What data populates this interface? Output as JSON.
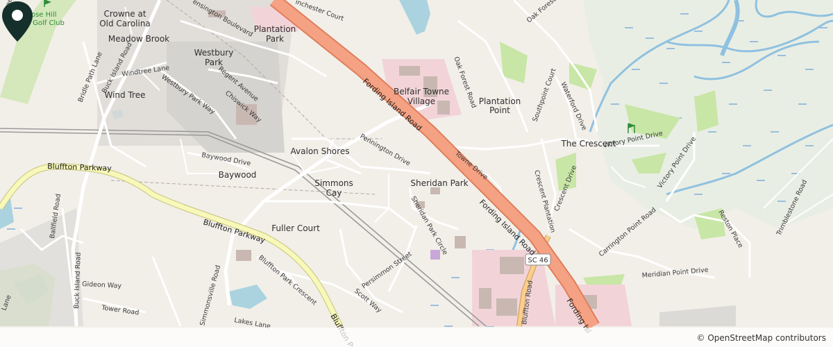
{
  "map": {
    "places": [
      {
        "id": "rose-hill-golf-club",
        "label": "Rose Hill"
      },
      {
        "id": "golf-club-2",
        "label": "Golf Club"
      },
      {
        "id": "crowne-at-old-carolina",
        "label": "Crowne at"
      },
      {
        "id": "crowne-at-old-carolina-2",
        "label": "Old Carolina"
      },
      {
        "id": "meadow-brook",
        "label": "Meadow Brook"
      },
      {
        "id": "plantation-park",
        "label": "Plantation"
      },
      {
        "id": "plantation-park-2",
        "label": "Park"
      },
      {
        "id": "westbury-park",
        "label": "Westbury"
      },
      {
        "id": "westbury-park-2",
        "label": "Park"
      },
      {
        "id": "wind-tree",
        "label": "Wind Tree"
      },
      {
        "id": "belfair-towne-village",
        "label": "Belfair Towne"
      },
      {
        "id": "belfair-towne-village-2",
        "label": "Village"
      },
      {
        "id": "plantation-point",
        "label": "Plantation"
      },
      {
        "id": "plantation-point-2",
        "label": "Point"
      },
      {
        "id": "the-crescent",
        "label": "The Crescent"
      },
      {
        "id": "avalon-shores",
        "label": "Avalon Shores"
      },
      {
        "id": "baywood",
        "label": "Baywood"
      },
      {
        "id": "simmons-cay",
        "label": "Simmons"
      },
      {
        "id": "simmons-cay-2",
        "label": "Cay"
      },
      {
        "id": "sheridan-park",
        "label": "Sheridan Park"
      },
      {
        "id": "fuller-court",
        "label": "Fuller Court"
      }
    ],
    "roads": [
      {
        "id": "fording-island-road-1",
        "label": "Fording Island Road"
      },
      {
        "id": "fording-island-road-2",
        "label": "Fording Island Road"
      },
      {
        "id": "fording-island-road-3",
        "label": "Fording Isl"
      },
      {
        "id": "bluffton-parkway-1",
        "label": "Bluffton Parkway"
      },
      {
        "id": "bluffton-parkway-2",
        "label": "Bluffton Parkway"
      },
      {
        "id": "bluffton-parkway-3",
        "label": "Bluffton Pa"
      },
      {
        "id": "buck-island-road-1",
        "label": "Buck Island Road"
      },
      {
        "id": "buck-island-road-2",
        "label": "Buck Island Road"
      },
      {
        "id": "bluffton-road",
        "label": "Bluffton Road"
      },
      {
        "id": "pennington-drive",
        "label": "Pennington Drive"
      },
      {
        "id": "towne-drive",
        "label": "Towne Drive"
      },
      {
        "id": "oak-forest-road",
        "label": "Oak Forest Road"
      },
      {
        "id": "oak-forest-road-2",
        "label": "Oak Forest Road"
      },
      {
        "id": "southpoint-court",
        "label": "Southpoint Court"
      },
      {
        "id": "waterford-drive",
        "label": "Waterford Drive"
      },
      {
        "id": "victory-point-drive",
        "label": "Victory Point Drive"
      },
      {
        "id": "victory-point-drive-2",
        "label": "Victory Point Drive"
      },
      {
        "id": "crescent-plantation",
        "label": "Crescent Plantation"
      },
      {
        "id": "crescent-drive",
        "label": "Crescent Drive"
      },
      {
        "id": "carrington-point-road",
        "label": "Carrington Point Road"
      },
      {
        "id": "reston-place",
        "label": "Reston Place"
      },
      {
        "id": "meridian-point-drive",
        "label": "Meridian Point Drive"
      },
      {
        "id": "trimblestone-road",
        "label": "Trimblestone Road"
      },
      {
        "id": "sheridan-park-circle",
        "label": "Sheridan Park Circle"
      },
      {
        "id": "persimmon-street",
        "label": "Persimmon Street"
      },
      {
        "id": "scott-way",
        "label": "Scott Way"
      },
      {
        "id": "simmonsville-road",
        "label": "Simmonsville Road"
      },
      {
        "id": "bluffton-park-crescent",
        "label": "Bluffton Park Crescent"
      },
      {
        "id": "gideon-way",
        "label": "Gideon Way"
      },
      {
        "id": "tower-road",
        "label": "Tower Road"
      },
      {
        "id": "ballfield-road",
        "label": "Ballfield Road"
      },
      {
        "id": "bridle-path-lane",
        "label": "Bridle Path Lane"
      },
      {
        "id": "windtree-lane",
        "label": "Windtree Lane"
      },
      {
        "id": "westbury-park-way",
        "label": "Westbury Park Way"
      },
      {
        "id": "regent-avenue",
        "label": "Regent Avenue"
      },
      {
        "id": "chiswick-way",
        "label": "Chiswick Way"
      },
      {
        "id": "baywood-drive",
        "label": "Baywood Drive"
      },
      {
        "id": "lakes-lane",
        "label": "Lakes Lane"
      },
      {
        "id": "kensington-boulevard",
        "label": "ensington Boulevard"
      },
      {
        "id": "winchester-court",
        "label": "inchester Court"
      },
      {
        "id": "greenw",
        "label": "Greenw"
      },
      {
        "id": "lane-left",
        "label": "Lane"
      }
    ],
    "shield": "SC 46",
    "attribution": "© OpenStreetMap contributors",
    "colors": {
      "land": "#f2efe9",
      "primary_road": "#f4a283",
      "primary_casing": "#e07d5a",
      "secondary_road": "#f7f8b9",
      "secondary_casing": "#c5c47a",
      "trunk_road": "#fbce8e",
      "water": "#aad3df",
      "park": "#c8e6a6",
      "commercial": "#f2d4d8",
      "residential": "#dcdad6",
      "pin": "#15302b"
    }
  }
}
